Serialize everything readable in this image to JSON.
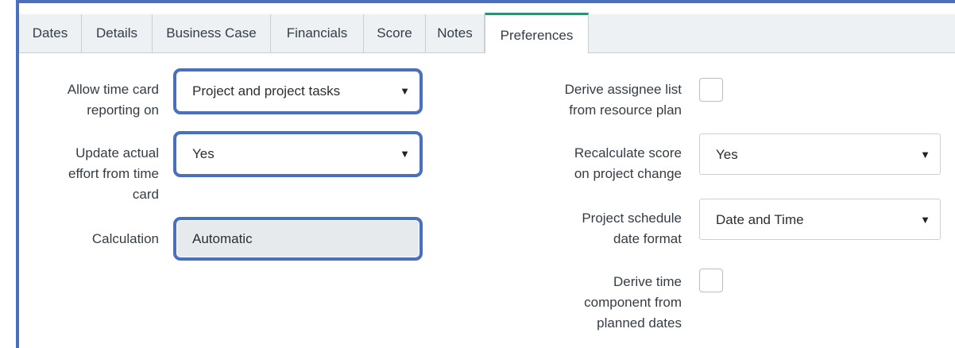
{
  "tabs": [
    "Dates",
    "Details",
    "Business Case",
    "Financials",
    "Score",
    "Notes",
    "Preferences"
  ],
  "active_tab": "Preferences",
  "left": {
    "time_card_reporting": {
      "label_line1": "Allow time card",
      "label_line2": "reporting on",
      "value": "Project and project tasks",
      "arrow": "▼"
    },
    "update_actual_effort": {
      "label_line1": "Update actual",
      "label_line2": "effort from time",
      "label_line3": "card",
      "value": "Yes",
      "arrow": "▼"
    },
    "calculation": {
      "label": "Calculation",
      "value": "Automatic"
    }
  },
  "right": {
    "derive_assignee": {
      "label_line1": "Derive assignee list",
      "label_line2": "from resource plan",
      "checked": false
    },
    "recalculate_score": {
      "label_line1": "Recalculate score",
      "label_line2": "on project change",
      "value": "Yes",
      "arrow": "▼"
    },
    "schedule_date_format": {
      "label_line1": "Project schedule",
      "label_line2": "date format",
      "value": "Date and Time",
      "arrow": "▼"
    },
    "derive_time_component": {
      "label_line1": "Derive time",
      "label_line2": "component from",
      "label_line3": "planned dates",
      "checked": false
    }
  },
  "colors": {
    "highlight": "#4a6fbd",
    "active_tab_accent": "#2e8e73",
    "tabbar_bg": "#edf1f3",
    "readonly_bg": "#e7eaec"
  }
}
